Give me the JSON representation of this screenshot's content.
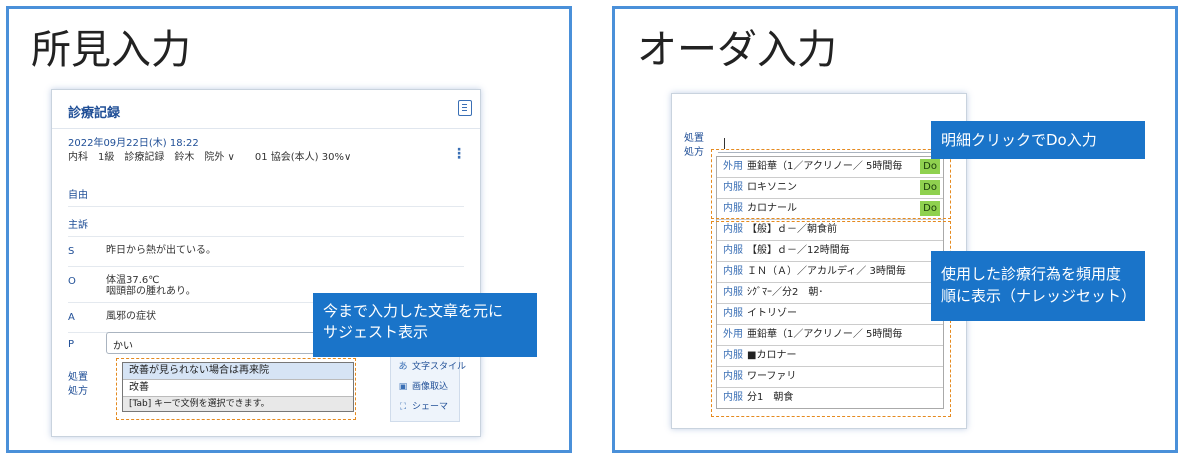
{
  "left_panel": {
    "title": "所見入力",
    "record": {
      "header_title": "診療記録",
      "date": "2022年09月22日(木) 18:22",
      "meta": "内科　1級　診療記録　鈴木　院外 ∨　　01 協会(本人) 30%∨",
      "fields": [
        {
          "label": "自由",
          "value": ""
        },
        {
          "label": "主訴",
          "value": ""
        },
        {
          "label": "S",
          "value": "昨日から熱が出ている。"
        },
        {
          "label": "O",
          "value": "体温37.6℃\n咽頭部の腫れあり。"
        },
        {
          "label": "A",
          "value": "風邪の症状"
        }
      ],
      "p_label": "P",
      "p_input_value": "かい",
      "prescription_label": "処置\n処方",
      "suggestions": [
        "改善が見られない場合は再来院",
        "改善"
      ],
      "suggestion_footer": "[Tab] キーで文例を選択できます。",
      "tools": [
        {
          "icon": "あ",
          "label": "文字スタイル"
        },
        {
          "icon": "▣",
          "label": "画像取込"
        },
        {
          "icon": "⛶",
          "label": "シェーマ"
        }
      ]
    },
    "callout": "今まで入力した文章を元に\nサジェスト表示"
  },
  "right_panel": {
    "title": "オーダ入力",
    "field_label": "処置\n処方",
    "do_items": [
      {
        "cat": "外用",
        "name": "亜鉛華（1／アクリノー／ 5時間毎",
        "do": "Do"
      },
      {
        "cat": "内服",
        "name": "ロキソニン",
        "do": "Do"
      },
      {
        "cat": "内服",
        "name": "カロナール",
        "do": "Do"
      }
    ],
    "knowledge_items": [
      {
        "cat": "内服",
        "name": "【般】ｄ－／朝食前"
      },
      {
        "cat": "内服",
        "name": "【般】ｄ－／12時間毎"
      },
      {
        "cat": "内服",
        "name": "ＩＮ（Ａ）／アカルディ／ 3時間毎"
      },
      {
        "cat": "内服",
        "name": "ｼｸﾞﾏｰ／分2　朝･"
      },
      {
        "cat": "内服",
        "name": "イトリゾー"
      },
      {
        "cat": "外用",
        "name": "亜鉛華（1／アクリノー／ 5時間毎"
      },
      {
        "cat": "内服",
        "name": "■カロナー"
      },
      {
        "cat": "内服",
        "name": "ワーファリ"
      },
      {
        "cat": "内服",
        "name": "分1　朝食"
      }
    ],
    "callout_do": "明細クリックでDo入力",
    "callout_knowledge": "使用した診療行為を頻用度\n順に表示（ナレッジセット）"
  },
  "colors": {
    "accent": "#1a74c9",
    "border": "#4a90d9",
    "dashed": "#e58a1f",
    "do_badge": "#8fd14f"
  }
}
